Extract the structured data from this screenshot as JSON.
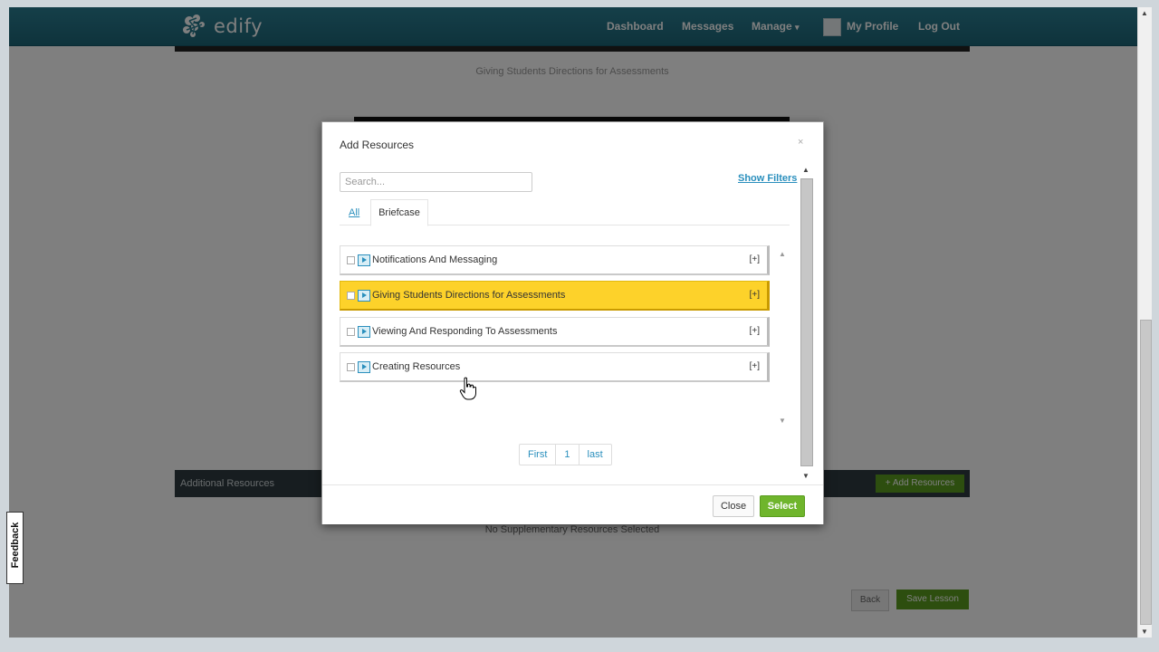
{
  "brand": {
    "name": "edify",
    "icon": "edify-logo-icon"
  },
  "nav": {
    "dashboard": "Dashboard",
    "messages": "Messages",
    "manage": "Manage",
    "manage_caret": "▾",
    "my_profile": "My Profile",
    "log_out": "Log Out",
    "profile_icon": "avatar-icon"
  },
  "page": {
    "lesson_title": "Giving Students Directions for Assessments",
    "additional_resources": "Additional Resources",
    "add_resources_button": "+ Add Resources",
    "no_supplementary": "No Supplementary Resources Selected",
    "back_button": "Back",
    "save_button": "Save Lesson"
  },
  "feedback": {
    "label": "Feedback"
  },
  "modal": {
    "title": "Add Resources",
    "close_x": "×",
    "search_placeholder": "Search...",
    "show_filters": "Show Filters",
    "tabs": {
      "all": "All",
      "briefcase": "Briefcase"
    },
    "resources": [
      {
        "label": "Notifications And Messaging",
        "expand": "[+]",
        "selected": false
      },
      {
        "label": "Giving Students Directions for Assessments",
        "expand": "[+]",
        "selected": true
      },
      {
        "label": "Viewing And Responding To Assessments",
        "expand": "[+]",
        "selected": false
      },
      {
        "label": "Creating Resources",
        "expand": "[+]",
        "selected": false
      }
    ],
    "pager": {
      "first": "First",
      "page": "1",
      "last": "last"
    },
    "buttons": {
      "close": "Close",
      "select": "Select"
    }
  },
  "colors": {
    "navbar": "#2b7f93",
    "selected_row": "#fdd22a",
    "link": "#2a8fbd",
    "primary_button": "#6fb52c"
  }
}
